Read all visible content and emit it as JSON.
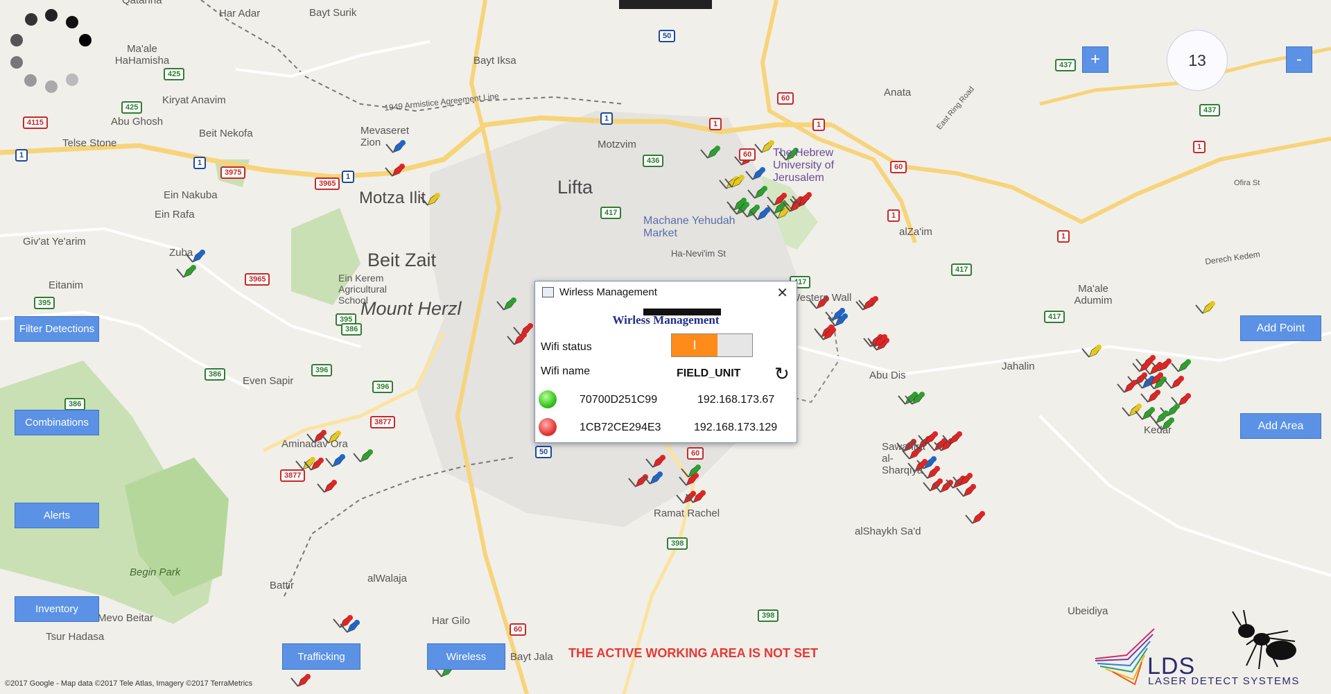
{
  "colors": {
    "button_blue": "#5b92e5",
    "toggle_on": "#ff8c1a",
    "warning_red": "#e53935",
    "dialog_heading": "#1f2d8f"
  },
  "top_bar": "",
  "zoom": {
    "plus_label": "+",
    "minus_label": "-",
    "level": "13"
  },
  "left_buttons": {
    "filter_detections": "Filter Detections",
    "combinations": "Combinations",
    "alerts": "Alerts",
    "inventory": "Inventory"
  },
  "bottom_buttons": {
    "trafficking": "Trafficking",
    "wireless": "Wireless"
  },
  "right_buttons": {
    "add_point": "Add Point",
    "add_area": "Add Area"
  },
  "warning": "THE ACTIVE WORKING AREA IS NOT SET",
  "copyright": "©2017 Google - Map data ©2017 Tele Atlas, Imagery ©2017 TerraMetrics",
  "logo": {
    "name": "LDS",
    "tagline": "LASER DETECT SYSTEMS"
  },
  "dialog": {
    "title": "Wirless Management",
    "heading": "Wirless Management",
    "wifi_status_label": "Wifi status",
    "wifi_status_on": true,
    "wifi_status_toggle_text": "I",
    "wifi_name_label": "Wifi name",
    "wifi_name": "FIELD_UNIT",
    "close_icon": "close-icon",
    "refresh_icon": "refresh-icon",
    "devices": [
      {
        "id": "70700D251C99",
        "ip": "192.168.173.67",
        "status": "green"
      },
      {
        "id": "1CB72CE294E3",
        "ip": "192.168.173.129",
        "status": "red"
      }
    ]
  },
  "map": {
    "places": [
      {
        "name": "Har Adar"
      },
      {
        "name": "Bayt Surik"
      },
      {
        "name": "Ma'ale HaHamisha"
      },
      {
        "name": "Bayt Iksa"
      },
      {
        "name": "Kiryat Anavim"
      },
      {
        "name": "Abu Ghosh"
      },
      {
        "name": "Beit Nekofa"
      },
      {
        "name": "Telse Stone"
      },
      {
        "name": "Mevaseret Zion"
      },
      {
        "name": "Ein Nakuba"
      },
      {
        "name": "Ein Rafa"
      },
      {
        "name": "Giv'at Ye'arim"
      },
      {
        "name": "Zuba"
      },
      {
        "name": "Eitanim"
      },
      {
        "name": "Lifta"
      },
      {
        "name": "Motza Ilit"
      },
      {
        "name": "Beit Zait"
      },
      {
        "name": "Mount Herzl"
      },
      {
        "name": "Ein Kerem Agricultural School"
      },
      {
        "name": "Even Sapir"
      },
      {
        "name": "Aminadav Ora"
      },
      {
        "name": "Begin Park"
      },
      {
        "name": "Battir"
      },
      {
        "name": "Mevo Beitar"
      },
      {
        "name": "Tsur Hadasa"
      },
      {
        "name": "alWalaja"
      },
      {
        "name": "Har Gilo"
      },
      {
        "name": "Bayt Jala"
      },
      {
        "name": "Ramat Rachel"
      },
      {
        "name": "Machane Yehudah Market"
      },
      {
        "name": "Ha-Nevi'im St"
      },
      {
        "name": "The Hebrew University of Jerusalem"
      },
      {
        "name": "Anata"
      },
      {
        "name": "alZa'im"
      },
      {
        "name": "Western Wall"
      },
      {
        "name": "Abu Dis"
      },
      {
        "name": "Jahalin"
      },
      {
        "name": "Ma'ale Adumim"
      },
      {
        "name": "Sawahira al-Sharqiya"
      },
      {
        "name": "alShaykh Sa'd"
      },
      {
        "name": "Ubeidiya"
      },
      {
        "name": "Derech Kedem"
      },
      {
        "name": "East Ring Road"
      },
      {
        "name": "Ofira St"
      },
      {
        "name": "Kedar"
      },
      {
        "name": "1949 Armistice Agreement Line"
      },
      {
        "name": "Motzvim"
      },
      {
        "name": "Qatanna"
      }
    ],
    "road_shields": [
      "50",
      "425",
      "425",
      "4115",
      "1",
      "1",
      "3975",
      "3965",
      "1",
      "1",
      "1",
      "436",
      "417",
      "417",
      "60",
      "60",
      "1",
      "1",
      "60",
      "1",
      "1",
      "437",
      "437",
      "417",
      "3965",
      "395",
      "395",
      "386",
      "386",
      "396",
      "396",
      "386",
      "3877",
      "3877",
      "50",
      "60",
      "398",
      "398",
      "60",
      "417"
    ],
    "pins": {
      "count": 95,
      "colors": [
        "red",
        "green",
        "blue",
        "yellow"
      ]
    }
  }
}
